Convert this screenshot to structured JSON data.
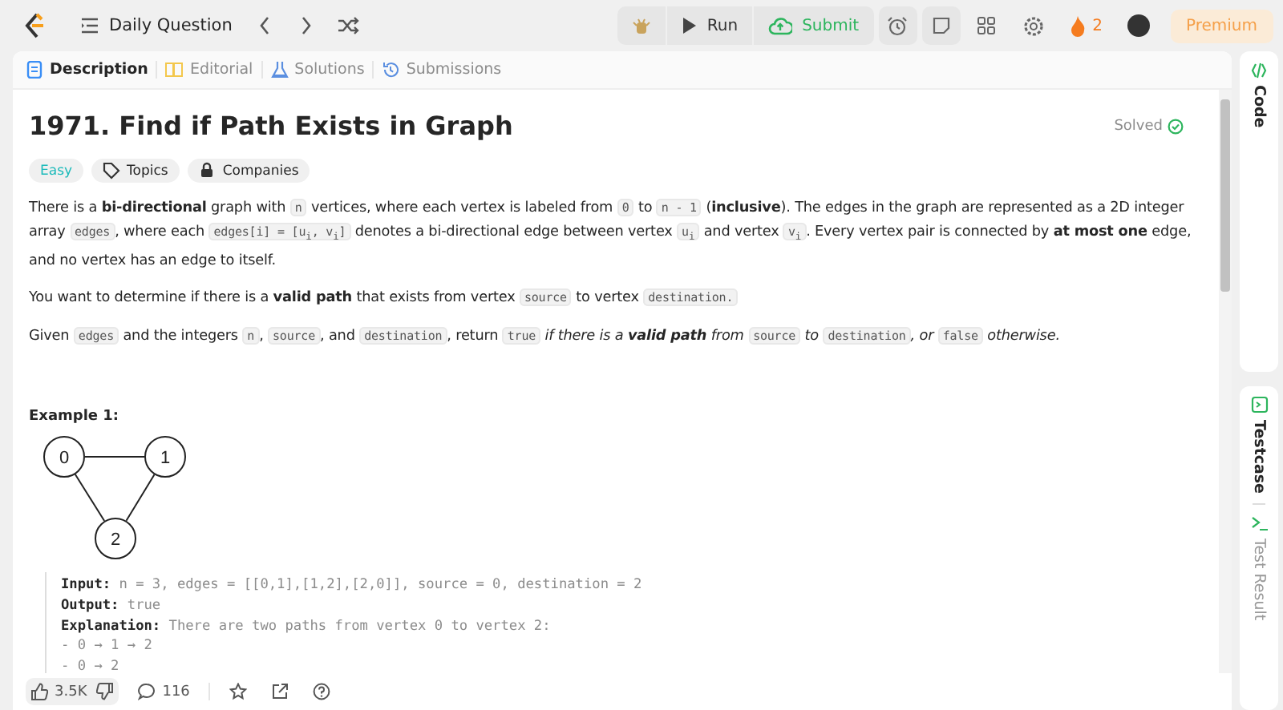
{
  "header": {
    "problem_list": "Daily Question",
    "run": "Run",
    "submit": "Submit",
    "streak": "2",
    "premium": "Premium"
  },
  "tabs": [
    {
      "label": "Description",
      "kind": "description",
      "selected": true
    },
    {
      "label": "Editorial",
      "kind": "editorial",
      "selected": false
    },
    {
      "label": "Solutions",
      "kind": "solutions",
      "selected": false
    },
    {
      "label": "Submissions",
      "kind": "submissions",
      "selected": false
    }
  ],
  "problem": {
    "title": "1971. Find if Path Exists in Graph",
    "status": "Solved",
    "difficulty": "Easy",
    "tags": [
      {
        "label": "Topics",
        "kind": "topics"
      },
      {
        "label": "Companies",
        "kind": "companies"
      }
    ],
    "paragraphs": [
      [
        {
          "kind": "text",
          "text": "There is a **bi-directional** graph with "
        },
        {
          "kind": "code",
          "text": "n"
        },
        {
          "kind": "text",
          "text": " vertices, where each vertex is labeled from "
        },
        {
          "kind": "code",
          "text": "0"
        },
        {
          "kind": "text",
          "text": " to "
        },
        {
          "kind": "code",
          "text": "n - 1"
        },
        {
          "kind": "text",
          "text": " (**inclusive**). The edges in the graph are represented as a 2D integer array "
        },
        {
          "kind": "code",
          "text": "edges"
        },
        {
          "kind": "text",
          "text": ", where each "
        },
        {
          "kind": "code",
          "text": "edges[i] = [u$_{i}$, v$_{i}$]"
        },
        {
          "kind": "text",
          "text": " denotes a bi-directional edge between vertex "
        },
        {
          "kind": "code",
          "text": "u$_{i}$"
        },
        {
          "kind": "text",
          "text": " and vertex "
        },
        {
          "kind": "code",
          "text": "v$_{i}$"
        },
        {
          "kind": "text",
          "text": ". Every vertex pair is connected by **at most one** edge, and no vertex has an edge to itself."
        }
      ],
      [
        {
          "kind": "text",
          "text": "You want to determine if there is a **valid path** that exists from vertex "
        },
        {
          "kind": "code",
          "text": "source"
        },
        {
          "kind": "text",
          "text": " to vertex "
        },
        {
          "kind": "code",
          "text": "destination."
        }
      ],
      [
        {
          "kind": "text",
          "text": "Given "
        },
        {
          "kind": "code",
          "text": "edges"
        },
        {
          "kind": "text",
          "text": " and the integers "
        },
        {
          "kind": "code",
          "text": "n"
        },
        {
          "kind": "text",
          "text": ", "
        },
        {
          "kind": "code",
          "text": "source"
        },
        {
          "kind": "text",
          "text": ", and "
        },
        {
          "kind": "code",
          "text": "destination"
        },
        {
          "kind": "text",
          "text": ", return "
        },
        {
          "kind": "code",
          "text": "true"
        },
        {
          "kind": "em",
          "text": " if there is a **valid path** from "
        },
        {
          "kind": "code",
          "text": "source"
        },
        {
          "kind": "em",
          "text": " to "
        },
        {
          "kind": "code",
          "text": "destination"
        },
        {
          "kind": "em",
          "text": ", or "
        },
        {
          "kind": "code",
          "text": "false"
        },
        {
          "kind": "em",
          "text": " otherwise."
        }
      ]
    ],
    "example": {
      "heading": "Example 1:",
      "graph_nodes": [
        "0",
        "1",
        "2"
      ],
      "lines": [
        {
          "label": "Input:",
          "value": "n = 3, edges = [[0,1],[1,2],[2,0]], source = 0, destination = 2"
        },
        {
          "label": "Output:",
          "value": "true"
        },
        {
          "label": "Explanation:",
          "value": "There are two paths from vertex 0 to vertex 2:"
        },
        {
          "value": "- 0 → 1 → 2"
        },
        {
          "value": "- 0 → 2"
        }
      ]
    }
  },
  "footer": {
    "likes": "3.5K",
    "comments": "116"
  },
  "side": {
    "code_label": "Code",
    "tabs": [
      {
        "label": "Testcase",
        "kind": "testcase",
        "selected": true
      },
      {
        "label": "Test Result",
        "kind": "result",
        "selected": false
      }
    ]
  }
}
